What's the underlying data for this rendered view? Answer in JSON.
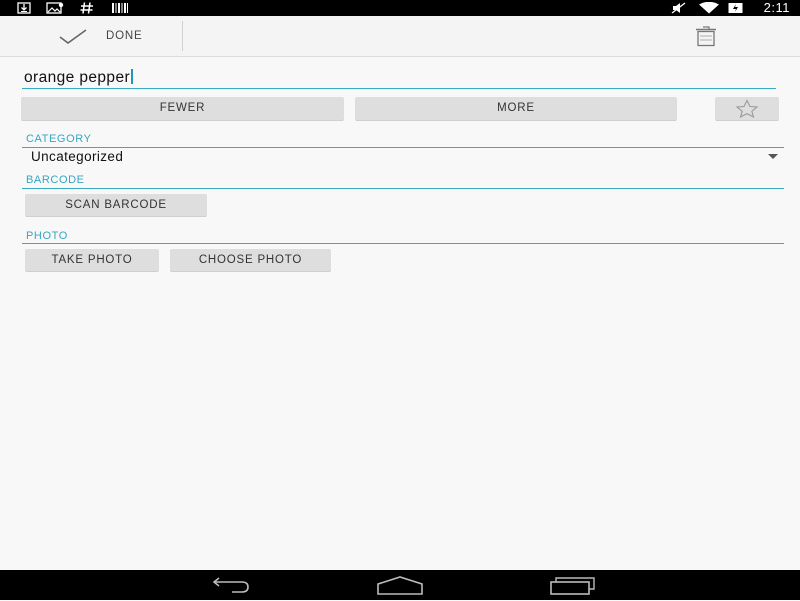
{
  "status_bar": {
    "time": "2:11",
    "icons": [
      "download-icon",
      "image-icon",
      "hash-icon",
      "barcode-icon",
      "mute-icon",
      "wifi-icon",
      "battery-charging-icon"
    ]
  },
  "action_bar": {
    "done_label": "DONE",
    "done_icon": "checkmark-icon",
    "delete_icon": "trash-icon"
  },
  "item": {
    "name_value": "orange pepper"
  },
  "quantity": {
    "fewer_label": "FEWER",
    "more_label": "MORE",
    "favorite_icon": "star-outline-icon"
  },
  "category": {
    "header": "CATEGORY",
    "selected": "Uncategorized"
  },
  "barcode": {
    "header": "BARCODE",
    "scan_label": "SCAN BARCODE"
  },
  "photo": {
    "header": "PHOTO",
    "take_label": "TAKE PHOTO",
    "choose_label": "CHOOSE PHOTO"
  },
  "nav_bar": {
    "icons": [
      "back-icon",
      "home-icon",
      "recents-icon"
    ]
  },
  "colors": {
    "accent": "#3aa9c4",
    "button_bg": "#dedede",
    "background": "#f8f8f8"
  }
}
